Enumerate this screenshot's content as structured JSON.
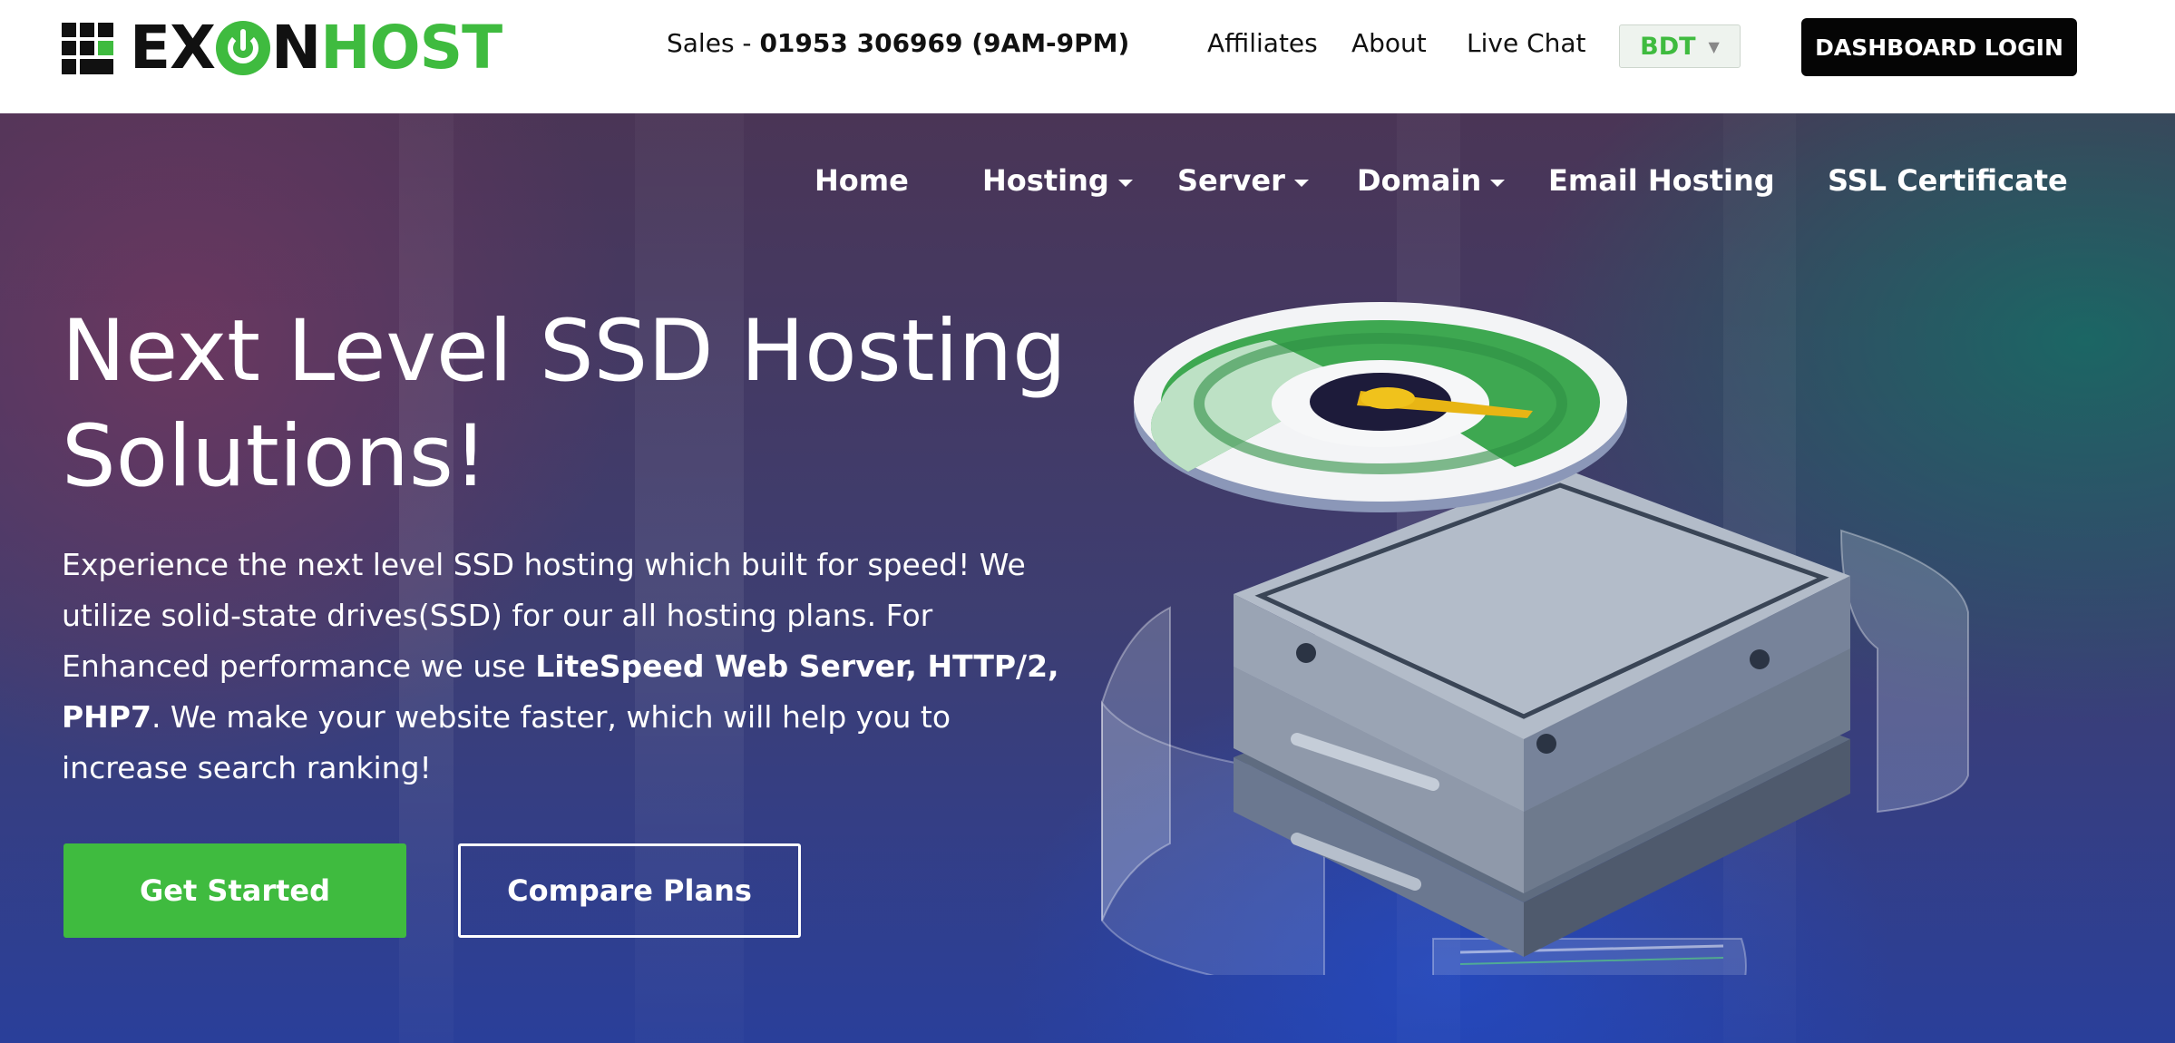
{
  "logo": {
    "ex": "EX",
    "n": "N",
    "host": "HOST"
  },
  "topbar": {
    "sales_prefix": "Sales - ",
    "sales_phone": "01953 306969 (9AM-9PM)",
    "links": [
      "Affiliates",
      "About",
      "Live Chat"
    ],
    "currency": "BDT",
    "dashboard_label": "DASHBOARD LOGIN"
  },
  "nav": {
    "items": [
      {
        "label": "Home"
      },
      {
        "label": "Hosting"
      },
      {
        "label": "Server"
      },
      {
        "label": "Domain"
      },
      {
        "label": "Email Hosting"
      },
      {
        "label": "SSL Certificate"
      }
    ]
  },
  "hero": {
    "title": "Next Level SSD Hosting Solutions!",
    "desc_part1": "Experience the next level SSD hosting which built for speed! We utilize solid-state drives(SSD) for our all hosting plans. For Enhanced performance we use ",
    "desc_bold": "LiteSpeed Web Server, HTTP/2, PHP7",
    "desc_part2": ". We make your website faster, which will help you to increase search ranking!",
    "cta_primary": "Get Started",
    "cta_secondary": "Compare Plans"
  },
  "colors": {
    "brand_green": "#3fbb3f",
    "dark": "#050505"
  }
}
